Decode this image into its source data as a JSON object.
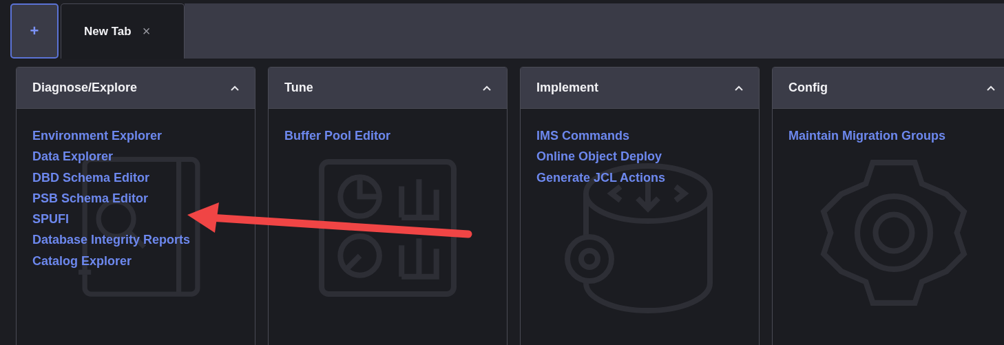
{
  "tabs_bar": {
    "new_tab_button": "+",
    "tabs": [
      {
        "label": "New Tab",
        "close": "×",
        "selected": true
      }
    ]
  },
  "panels": [
    {
      "title": "Diagnose/Explore",
      "expanded": true,
      "kind": "book-search",
      "links": [
        "Environment Explorer",
        "Data Explorer",
        "DBD Schema Editor",
        "PSB Schema Editor",
        "SPUFI",
        "Database Integrity Reports",
        "Catalog Explorer"
      ]
    },
    {
      "title": "Tune",
      "expanded": true,
      "kind": "dashboard",
      "links": [
        "Buffer Pool Editor"
      ]
    },
    {
      "title": "Implement",
      "expanded": true,
      "kind": "database-gear",
      "links": [
        "IMS Commands",
        "Online Object Deploy",
        "Generate JCL Actions"
      ]
    },
    {
      "title": "Config",
      "expanded": true,
      "kind": "gear",
      "links": [
        "Maintain Migration Groups"
      ]
    }
  ]
}
